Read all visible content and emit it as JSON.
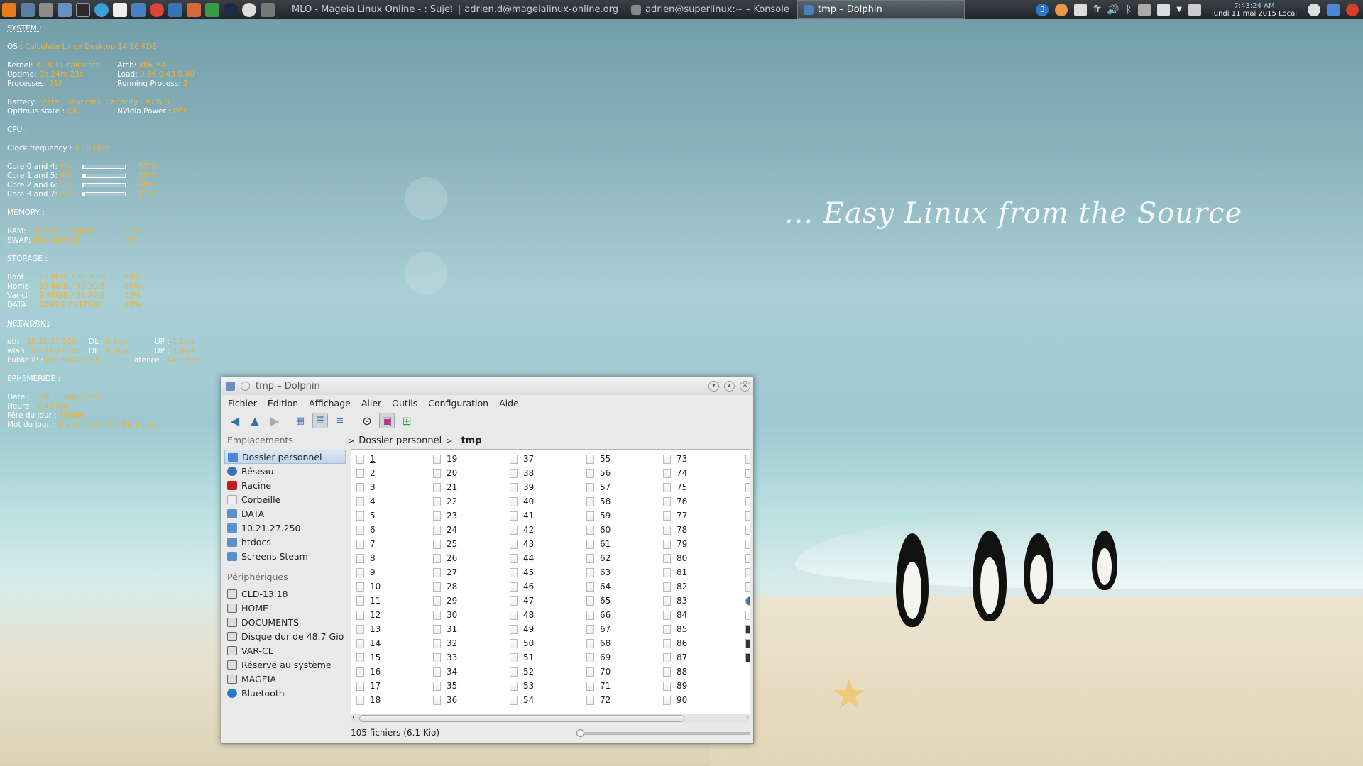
{
  "taskbar": {
    "tasks": [
      {
        "label": "MLO - Mageia Linux Online - : Sujet",
        "active": false
      },
      {
        "label": "adrien.d@mageialinux-online.org",
        "active": false
      },
      {
        "label": "adrien@superlinux:~ – Konsole",
        "active": false
      },
      {
        "label": "tmp – Dolphin",
        "active": true
      }
    ],
    "badge": "3",
    "lang": "fr",
    "clock_time": "7:43:24 AM",
    "clock_date": "lundi 11 mai 2015 Local"
  },
  "wallpaper": {
    "tagline": "... Easy Linux from the Source"
  },
  "conky": {
    "system_h": "SYSTEM :",
    "os_l": "OS :",
    "os_v": "Calculate Linux Desktop 14.16 KDE",
    "kernel_l": "Kernel:",
    "kernel_v": "3.18.11-calculate",
    "arch_l": "Arch:",
    "arch_v": "x86_64",
    "uptime_l": "Uptime:",
    "uptime_v": "0h 24m 23s",
    "load_l": "Load:",
    "load_v": "0.36 0.43 0.40",
    "proc_l": "Processes:",
    "proc_v": "218",
    "run_l": "Running Process:",
    "run_v": "2",
    "battery_l": "Battery:",
    "battery_v": "State : Unknown,  Capacity : 97%  ()",
    "optimus_l": "Optimus state :",
    "optimus_v": "OK",
    "nvidia_l": "NVidia Power :",
    "nvidia_v": "OFF",
    "cpu_h": "CPU :",
    "clock_l": "Clock frequency :",
    "clock_v": "3.10 GHz",
    "cores": [
      {
        "label": "Core 0 and 4:",
        "pct": "4%",
        "temp": "57°C",
        "load": 0.04
      },
      {
        "label": "Core 1 and 5:",
        "pct": "8%",
        "temp": "55°C",
        "load": 0.08
      },
      {
        "label": "Core 2 and 6:",
        "pct": "5%",
        "temp": "60°C",
        "load": 0.05
      },
      {
        "label": "Core 3 and 7:",
        "pct": "7%",
        "temp": "61°C",
        "load": 0.07
      }
    ],
    "memory_h": "MEMORY :",
    "ram_l": "RAM:",
    "ram_v": "1.62GiB / 7.68GiB",
    "ram_p": "21%",
    "swap_l": "SWAP:",
    "swap_v": "0B  / 8.00GiB",
    "swap_p": "0%",
    "storage_h": "STORAGE :",
    "storage": [
      {
        "label": "Root",
        "v": "15.8GiB / 28.7GiB",
        "p": "54%"
      },
      {
        "label": "Home",
        "v": "55.8GiB / 92.2GiB",
        "p": "60%"
      },
      {
        "label": "Var-cl",
        "v": "9.50GiB / 28.7GiB",
        "p": "33%"
      },
      {
        "label": "DATA",
        "v": "829GiB / 917GiB",
        "p": "90%"
      }
    ],
    "network_h": "NETWORK :",
    "eth_l": "eth :",
    "eth_v": "10.21.27.100",
    "eth_dl_l": "DL :",
    "eth_dl_v": "0.1k/s",
    "eth_up_l": "UP :",
    "eth_up_v": "0.1k/s",
    "wlan_l": "wlan :",
    "wlan_v": "10.21.27.101",
    "wlan_dl_l": "DL :",
    "wlan_dl_v": "0.0k/s",
    "wlan_up_l": "UP :",
    "wlan_up_v": "0.0k/s",
    "pub_l": "Public IP :",
    "pub_v": "89.158.40.230",
    "lat_l": "Latence :",
    "lat_v": "44.5 ms",
    "ephem_h": "EPHEMERIDE :",
    "date_l": "Date :",
    "date_v": "lundi 11 mai 2015",
    "hour_l": "Heure :",
    "hour_v": "7:43 AM",
    "fete_l": "Fête du jour :",
    "fete_v": "Estelle",
    "mot_l": "Mot du jour :",
    "mot_v": "er'virer de bord : Déranger"
  },
  "dolphin": {
    "title": "tmp – Dolphin",
    "menu": [
      "Fichier",
      "Édition",
      "Affichage",
      "Aller",
      "Outils",
      "Configuration",
      "Aide"
    ],
    "places_header": "Emplacements",
    "places": [
      "Dossier personnel",
      "Réseau",
      "Racine",
      "Corbeille",
      "DATA",
      "10.21.27.250",
      "htdocs",
      "Screens Steam"
    ],
    "devices_header": "Périphériques",
    "devices": [
      "CLD-13.18",
      "HOME",
      "DOCUMENTS",
      "Disque dur de 48.7 Gio",
      "VAR-CL",
      "Réservé au système",
      "MAGEIA",
      "Bluetooth"
    ],
    "breadcrumb": [
      "Dossier personnel",
      "tmp"
    ],
    "status": "105 fichiers (6.1 Kio)",
    "zoom": 0
  }
}
